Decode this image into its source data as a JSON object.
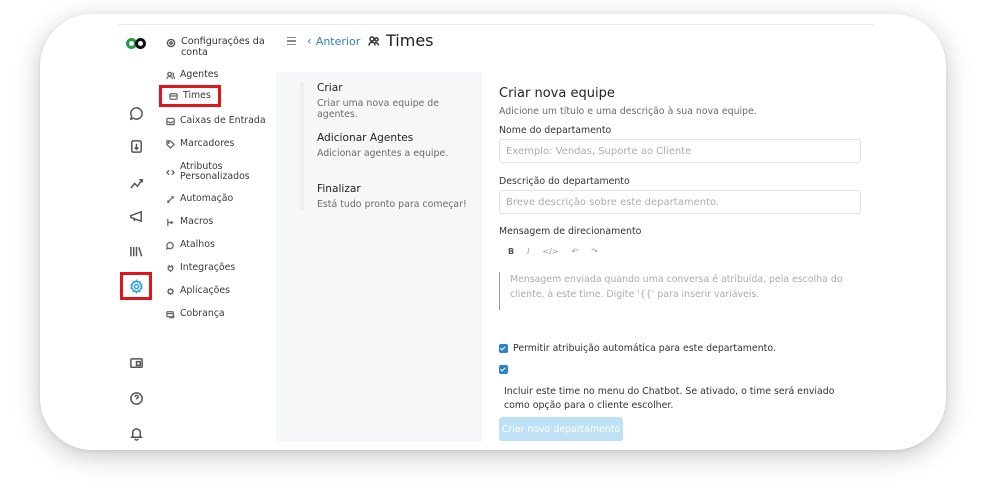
{
  "header": {
    "back_label": "Anterior",
    "title": "Times"
  },
  "rail": {
    "icons": [
      "conversations-icon",
      "contacts-icon",
      "reports-icon",
      "campaigns-icon",
      "library-icon",
      "settings-icon",
      "screen-icon",
      "help-icon",
      "notifications-icon"
    ],
    "active": "settings-icon"
  },
  "sidebar": {
    "header": "Configurações da conta",
    "items": [
      {
        "label": "Agentes"
      },
      {
        "label": "Times"
      },
      {
        "label": "Caixas de Entrada"
      },
      {
        "label": "Marcadores"
      },
      {
        "label": "Atributos Personalizados"
      },
      {
        "label": "Automação"
      },
      {
        "label": "Macros"
      },
      {
        "label": "Atalhos"
      },
      {
        "label": "Integrações"
      },
      {
        "label": "Aplicações"
      },
      {
        "label": "Cobrança"
      }
    ],
    "active": "Times"
  },
  "steps": [
    {
      "title": "Criar",
      "desc": "Criar uma nova equipe de agentes."
    },
    {
      "title": "Adicionar Agentes",
      "desc": "Adicionar agentes a equipe."
    },
    {
      "title": "Finalizar",
      "desc": "Está tudo pronto para começar!"
    }
  ],
  "form": {
    "title": "Criar nova equipe",
    "subtitle": "Adicione um título e uma descrição à sua nova equipe.",
    "name_label": "Nome do departamento",
    "name_placeholder": "Exemplo: Vendas, Suporte ao Cliente",
    "name_value": "",
    "desc_label": "Descrição do departamento",
    "desc_placeholder": "Breve descrição sobre este departamento.",
    "desc_value": "",
    "routing_label": "Mensagem de direcionamento",
    "toolbar": [
      "B",
      "I",
      "</>",
      "↶",
      "↷"
    ],
    "routing_placeholder": "Mensagem enviada quando uma conversa é atribuída, pela escolha do cliente, à este time. Digite '{{' para inserir variáveis.",
    "auto_assign_label": "Permitir atribuição automática para este departamento.",
    "auto_assign_checked": true,
    "chatbot_checked": true,
    "chatbot_label": "Incluir este time no menu do Chatbot. Se ativado, o time será enviado como opção para o cliente escolher.",
    "submit_label": "Criar novo departamento"
  },
  "colors": {
    "accent": "#2b84c9",
    "highlight": "#e0141b",
    "submit_disabled": "#bfe1f6"
  }
}
